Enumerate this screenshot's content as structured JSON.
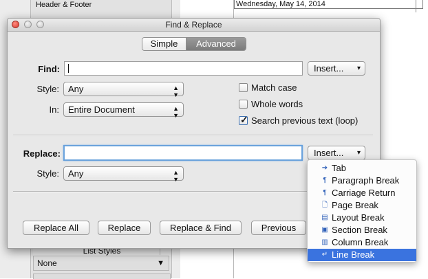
{
  "background": {
    "sidebar_item": "Header & Footer",
    "date_field": "Wednesday, May 14, 2014",
    "list_styles_header": "List Styles",
    "list_style_value": "None"
  },
  "dialog": {
    "title": "Find & Replace",
    "tabs": [
      {
        "label": "Simple",
        "selected": false
      },
      {
        "label": "Advanced",
        "selected": true
      }
    ],
    "find": {
      "label": "Find:",
      "value": "",
      "insert_label": "Insert...",
      "style_label": "Style:",
      "style_value": "Any",
      "in_label": "In:",
      "in_value": "Entire Document"
    },
    "options": [
      {
        "label": "Match case",
        "checked": false
      },
      {
        "label": "Whole words",
        "checked": false
      },
      {
        "label": "Search previous text (loop)",
        "checked": true
      }
    ],
    "replace": {
      "label": "Replace:",
      "value": "",
      "insert_label": "Insert...",
      "style_label": "Style:",
      "style_value": "Any"
    },
    "buttons": {
      "replace_all": "Replace All",
      "replace": "Replace",
      "replace_find": "Replace & Find",
      "previous": "Previous"
    }
  },
  "insert_menu": {
    "items": [
      {
        "label": "Tab",
        "icon": "tab-arrow-icon"
      },
      {
        "label": "Paragraph Break",
        "icon": "pilcrow-icon"
      },
      {
        "label": "Carriage Return",
        "icon": "pilcrow-icon"
      },
      {
        "label": "Page Break",
        "icon": "page-icon"
      },
      {
        "label": "Layout Break",
        "icon": "layout-break-icon"
      },
      {
        "label": "Section Break",
        "icon": "section-break-icon"
      },
      {
        "label": "Column Break",
        "icon": "column-break-icon"
      },
      {
        "label": "Line Break",
        "icon": "line-break-icon",
        "selected": true
      }
    ]
  },
  "colors": {
    "accent": "#3a73df",
    "focus_ring": "#6aa2dc",
    "close_button": "#d6382e"
  }
}
